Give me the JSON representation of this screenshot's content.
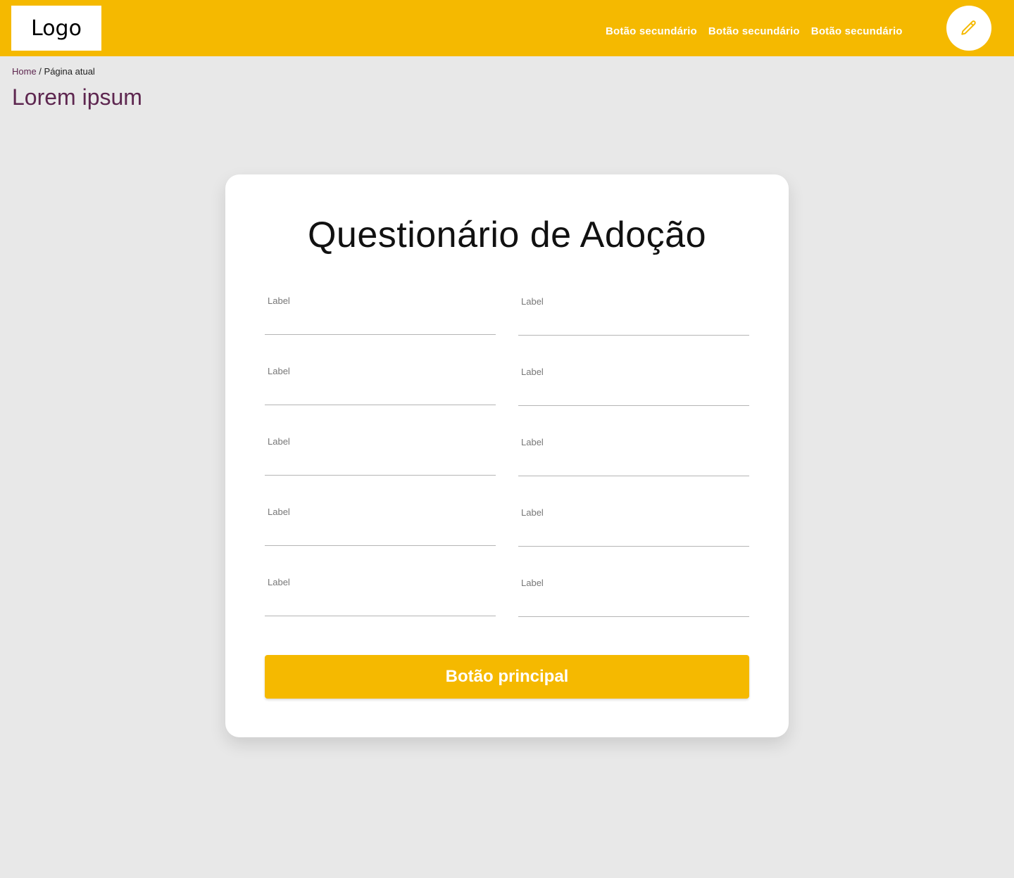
{
  "header": {
    "logo_text": "Logo",
    "nav": [
      "Botão secundário",
      "Botão secundário",
      "Botão secundário"
    ],
    "edit_icon": "pencil-icon",
    "background_color": "#f5b900"
  },
  "breadcrumb": {
    "home": "Home",
    "separator": " / ",
    "current": "Página atual"
  },
  "page_title": "Lorem ipsum",
  "form": {
    "title": "Questionário de Adoção",
    "fields": [
      {
        "label": "Label",
        "value": ""
      },
      {
        "label": "Label",
        "value": ""
      },
      {
        "label": "Label",
        "value": ""
      },
      {
        "label": "Label",
        "value": ""
      },
      {
        "label": "Label",
        "value": ""
      },
      {
        "label": "Label",
        "value": ""
      },
      {
        "label": "Label",
        "value": ""
      },
      {
        "label": "Label",
        "value": ""
      },
      {
        "label": "Label",
        "value": ""
      },
      {
        "label": "Label",
        "value": ""
      }
    ],
    "submit_label": "Botão principal"
  },
  "colors": {
    "accent": "#f5b900",
    "brand_purple": "#5e2750",
    "background": "#e8e8e8"
  }
}
